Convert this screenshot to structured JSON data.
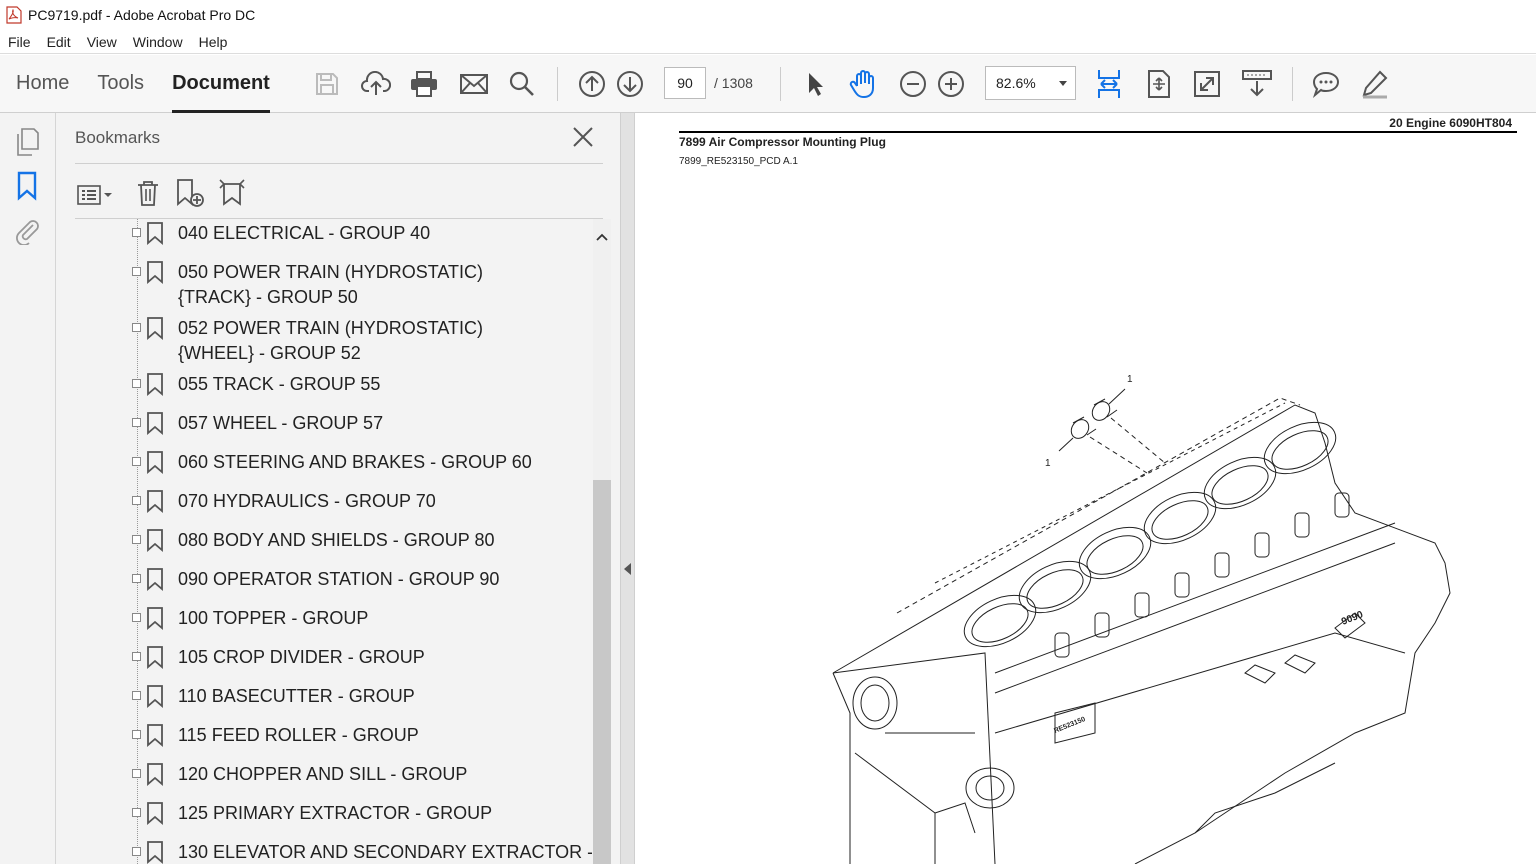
{
  "window": {
    "title": "PC9719.pdf - Adobe Acrobat Pro DC"
  },
  "menu": [
    "File",
    "Edit",
    "View",
    "Window",
    "Help"
  ],
  "nav_tabs": [
    {
      "label": "Home"
    },
    {
      "label": "Tools"
    },
    {
      "label": "Document",
      "active": true
    }
  ],
  "toolbar": {
    "page_current": "90",
    "page_total": "/ 1308",
    "zoom": "82.6%"
  },
  "panel": {
    "title": "Bookmarks",
    "items": [
      {
        "label": "040 ELECTRICAL - GROUP 40"
      },
      {
        "label": "050 POWER TRAIN (HYDROSTATIC){TRACK} - GROUP 50"
      },
      {
        "label": "052 POWER TRAIN (HYDROSTATIC){WHEEL} - GROUP 52"
      },
      {
        "label": "055 TRACK - GROUP 55"
      },
      {
        "label": "057 WHEEL - GROUP 57"
      },
      {
        "label": "060 STEERING AND BRAKES - GROUP 60"
      },
      {
        "label": "070 HYDRAULICS - GROUP 70"
      },
      {
        "label": "080 BODY AND SHIELDS - GROUP 80"
      },
      {
        "label": "090 OPERATOR STATION - GROUP 90"
      },
      {
        "label": "100 TOPPER - GROUP"
      },
      {
        "label": "105 CROP DIVIDER - GROUP"
      },
      {
        "label": "110 BASECUTTER - GROUP"
      },
      {
        "label": "115 FEED ROLLER - GROUP"
      },
      {
        "label": "120 CHOPPER AND SILL - GROUP"
      },
      {
        "label": "125 PRIMARY EXTRACTOR - GROUP"
      },
      {
        "label": "130 ELEVATOR AND SECONDARY EXTRACTOR -"
      }
    ]
  },
  "document": {
    "header_right": "20  Engine  6090HT804",
    "title": "7899 Air Compressor Mounting Plug",
    "subtitle": "7899_RE523150_PCD A.1",
    "callout_1": "1",
    "callout_2": "1",
    "casting_mark_a": "9090",
    "casting_mark_b": "RE523150"
  }
}
